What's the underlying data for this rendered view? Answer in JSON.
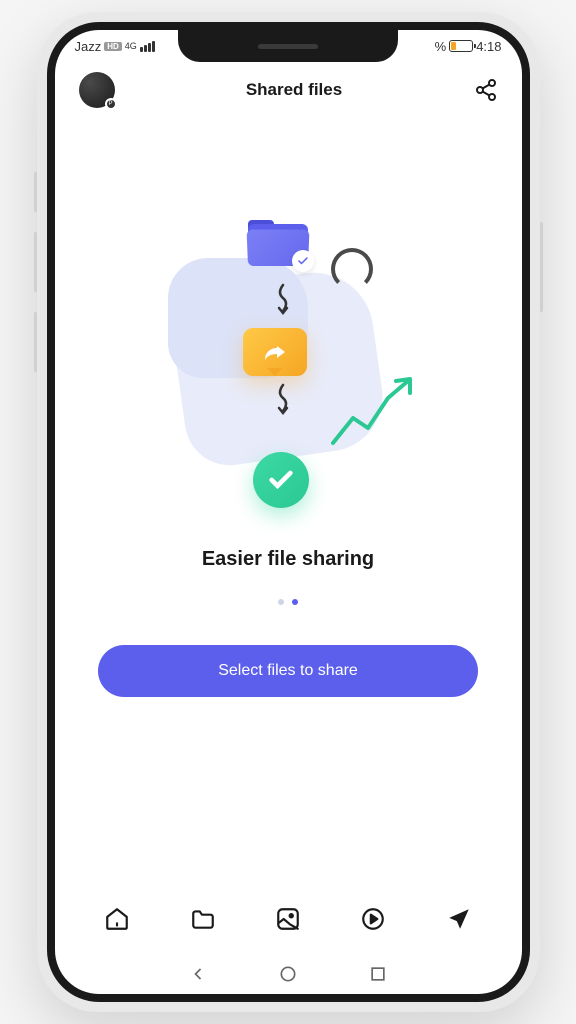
{
  "status_bar": {
    "carrier": "Jazz",
    "network_badge": "HD",
    "network_type": "4G",
    "battery_pct": "%",
    "time": "4:18"
  },
  "header": {
    "title": "Shared files",
    "avatar_badge": "P"
  },
  "main": {
    "heading": "Easier file sharing",
    "cta_label": "Select files to share"
  },
  "pager": {
    "total": 2,
    "active_index": 1
  }
}
